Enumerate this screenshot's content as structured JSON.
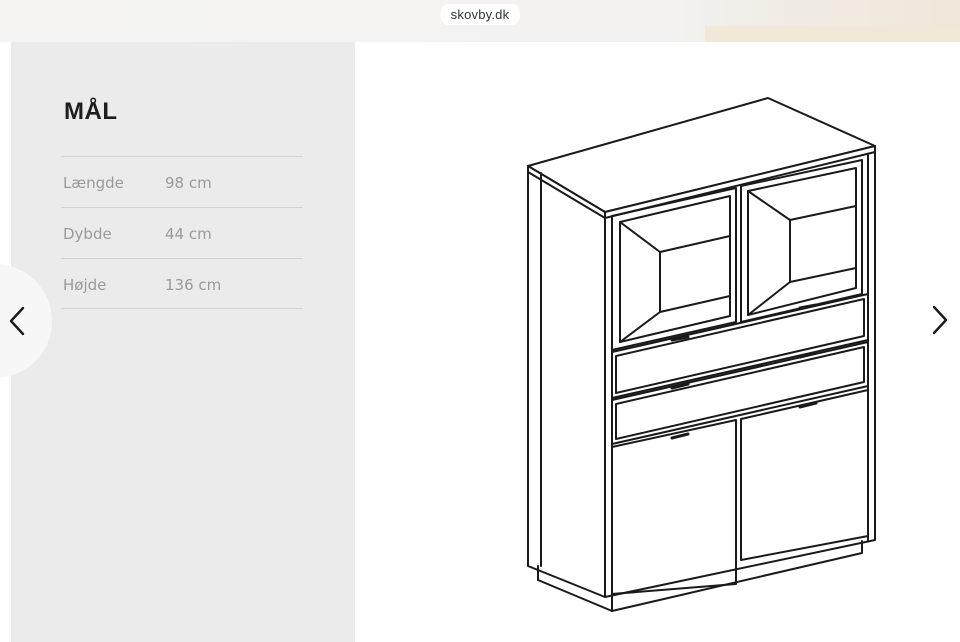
{
  "browser": {
    "url": "skovby.dk"
  },
  "specs": {
    "title": "MÅL",
    "rows": [
      {
        "label": "Længde",
        "value": "98 cm"
      },
      {
        "label": "Dybde",
        "value": "44 cm"
      },
      {
        "label": "Højde",
        "value": "136 cm"
      }
    ]
  },
  "icons": {
    "prev": "chevron-left-icon",
    "next": "chevron-right-icon"
  },
  "colors": {
    "panel": "#ebebeb",
    "line": "#1a1a1a",
    "muted_text": "#9a9a9a"
  }
}
